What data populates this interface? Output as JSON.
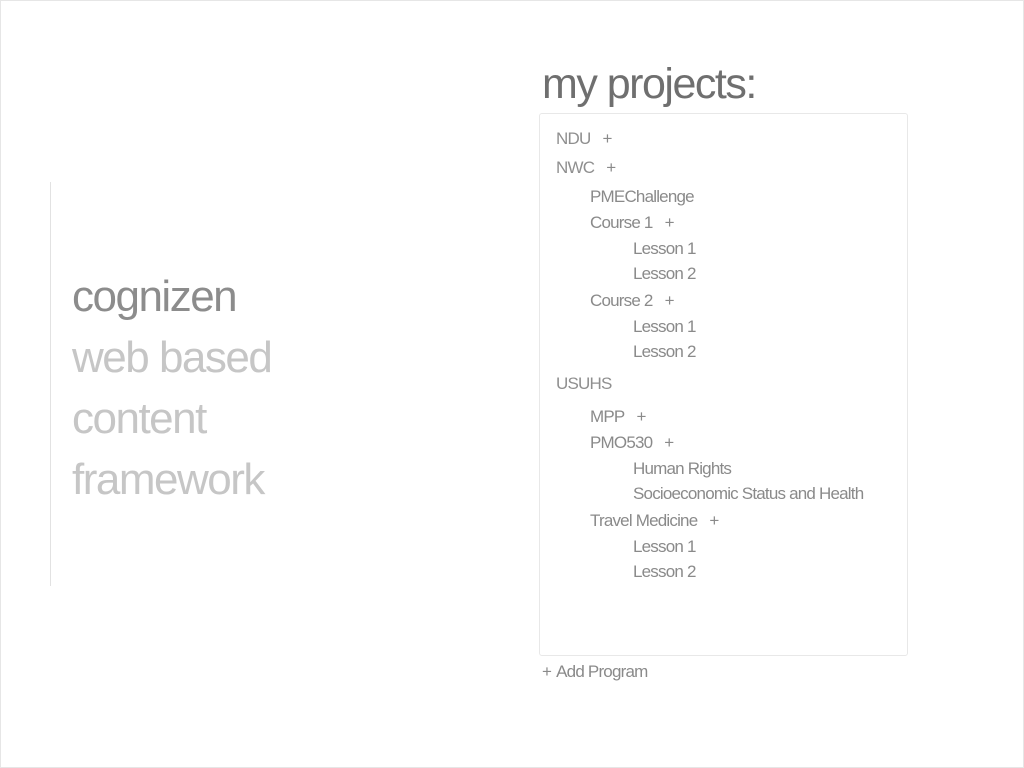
{
  "brand": {
    "name": "cognizen",
    "tagline_lines": [
      "web based",
      "content",
      "framework"
    ]
  },
  "projects": {
    "title": "my projects:",
    "tree": [
      {
        "label": "NDU",
        "has_add": true
      },
      {
        "label": "NWC",
        "has_add": true
      },
      {
        "label": "PMEChallenge",
        "has_add": false
      },
      {
        "label": "Course 1",
        "has_add": true
      },
      {
        "label": "Lesson 1",
        "has_add": false
      },
      {
        "label": "Lesson 2",
        "has_add": false
      },
      {
        "label": "Course 2",
        "has_add": true
      },
      {
        "label": "Lesson 1",
        "has_add": false
      },
      {
        "label": "Lesson 2",
        "has_add": false
      },
      {
        "label": "USUHS",
        "has_add": false
      },
      {
        "label": "MPP",
        "has_add": true
      },
      {
        "label": "PMO530",
        "has_add": true
      },
      {
        "label": "Human Rights",
        "has_add": false
      },
      {
        "label": "Socioeconomic Status and Health",
        "has_add": false
      },
      {
        "label": "Travel Medicine",
        "has_add": true
      },
      {
        "label": "Lesson 1",
        "has_add": false
      },
      {
        "label": "Lesson 2",
        "has_add": false
      }
    ],
    "plus_glyph": "+"
  },
  "add_program": {
    "plus": "+",
    "label": "Add Program"
  }
}
